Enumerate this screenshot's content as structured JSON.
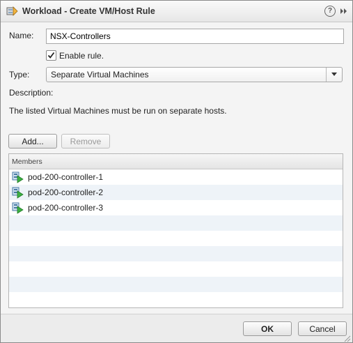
{
  "dialog": {
    "title": "Workload - Create VM/Host Rule",
    "help_glyph": "?"
  },
  "form": {
    "name_label": "Name:",
    "name_value": "NSX-Controllers",
    "enable_label": "Enable rule.",
    "enable_checked": true,
    "type_label": "Type:",
    "type_value": "Separate Virtual Machines",
    "description_label": "Description:",
    "description_text": "The listed Virtual Machines must be run on separate hosts."
  },
  "members_toolbar": {
    "add_label": "Add...",
    "remove_label": "Remove"
  },
  "members_table": {
    "header": "Members",
    "rows": [
      "pod-200-controller-1",
      "pod-200-controller-2",
      "pod-200-controller-3"
    ]
  },
  "footer": {
    "ok_label": "OK",
    "cancel_label": "Cancel"
  },
  "icons": {
    "title": "rule-icon",
    "help": "help-icon",
    "expand": "double-chevron-right-icon",
    "vm": "virtual-machine-icon",
    "dropdown": "chevron-down-icon"
  }
}
